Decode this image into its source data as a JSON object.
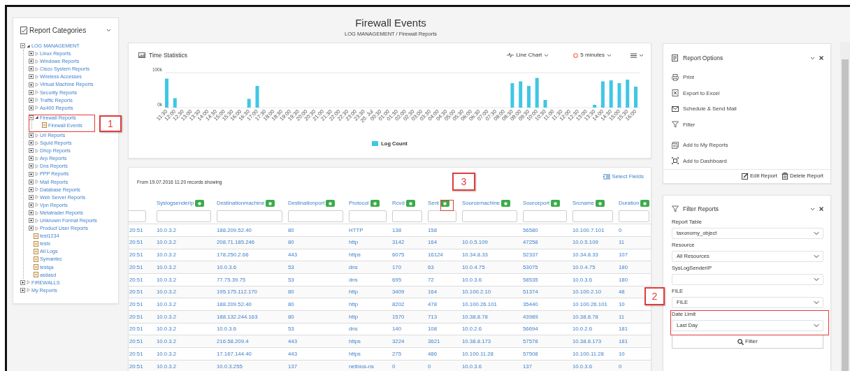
{
  "page": {
    "title": "Firewall Events",
    "breadcrumb": "LOG MANAGEMENT / Firewall Reports"
  },
  "sidebar": {
    "title": "Report Categories",
    "tree": [
      {
        "label": "LOG MANAGEMENT",
        "kind": "folder",
        "expanded": true,
        "children": [
          {
            "label": "Linux Reports",
            "kind": "folder",
            "expanded": false
          },
          {
            "label": "Windows Reports",
            "kind": "folder",
            "expanded": false
          },
          {
            "label": "Cisco System Reports",
            "kind": "folder",
            "expanded": false
          },
          {
            "label": "Wireless Accesses",
            "kind": "folder",
            "expanded": false
          },
          {
            "label": "Virtual Machine Reports",
            "kind": "folder",
            "expanded": false
          },
          {
            "label": "Security Reports",
            "kind": "folder",
            "expanded": false
          },
          {
            "label": "Traffic Reports",
            "kind": "folder",
            "expanded": false
          },
          {
            "label": "As400 Reports",
            "kind": "folder",
            "expanded": false
          },
          {
            "label": "Firewall Reports",
            "kind": "folder",
            "expanded": true,
            "children": [
              {
                "label": "Firewall Events",
                "kind": "report"
              }
            ]
          },
          {
            "label": "Url Reports",
            "kind": "folder",
            "expanded": false
          },
          {
            "label": "Squid Reports",
            "kind": "folder",
            "expanded": false
          },
          {
            "label": "Dhcp Reports",
            "kind": "folder",
            "expanded": false
          },
          {
            "label": "Arp Reports",
            "kind": "folder",
            "expanded": false
          },
          {
            "label": "Dns Reports",
            "kind": "folder",
            "expanded": false
          },
          {
            "label": "PPP Reports",
            "kind": "folder",
            "expanded": false
          },
          {
            "label": "Mail Reports",
            "kind": "folder",
            "expanded": false
          },
          {
            "label": "Database Reports",
            "kind": "folder",
            "expanded": false
          },
          {
            "label": "Web Server Reports",
            "kind": "folder",
            "expanded": false
          },
          {
            "label": "Vpn Reports",
            "kind": "folder",
            "expanded": false
          },
          {
            "label": "Metatrader Reports",
            "kind": "folder",
            "expanded": false
          },
          {
            "label": "Unknown Format Reports",
            "kind": "folder",
            "expanded": false
          },
          {
            "label": "Product User Reports",
            "kind": "folder",
            "expanded": false
          },
          {
            "label": "test1234",
            "kind": "report"
          },
          {
            "label": "testx",
            "kind": "report"
          },
          {
            "label": "All Logs",
            "kind": "report"
          },
          {
            "label": "Symantec",
            "kind": "report"
          },
          {
            "label": "testqa",
            "kind": "report"
          },
          {
            "label": "asdasd",
            "kind": "report"
          }
        ]
      },
      {
        "label": "FIREWALLS",
        "kind": "folder",
        "expanded": false
      },
      {
        "label": "My Reports",
        "kind": "folder",
        "expanded": false
      }
    ]
  },
  "time_statistics": {
    "title": "Time Statistics",
    "chart_type": "Line Chart",
    "interval": "5 minutes",
    "chart_data": {
      "type": "bar",
      "categories": [
        "11:30",
        "12:00",
        "12:30",
        "13:00",
        "13:30",
        "14:00",
        "14:30",
        "15:00",
        "15:30",
        "16:00",
        "16:30",
        "17:00",
        "17:30",
        "18:00",
        "18:30",
        "19:00",
        "19:30",
        "20:00",
        "20:30",
        "21:00",
        "21:30",
        "22:00",
        "22:30",
        "23:00",
        "23:30",
        "20. Jul",
        "00:30",
        "01:00",
        "01:30",
        "02:00",
        "02:30",
        "03:00",
        "03:30",
        "04:00",
        "04:30",
        "05:00",
        "05:30",
        "06:00",
        "06:30",
        "07:00",
        "07:30",
        "08:00",
        "08:30",
        "09:00",
        "09:30",
        "10:00",
        "10:30",
        "11:00",
        "11:30",
        "12:00",
        "12:30",
        "13:00",
        "13:30",
        "14:00",
        "14:30",
        "15:00",
        "15:30",
        "16:00"
      ],
      "series": [
        {
          "name": "Log Count",
          "color": "#3fc7e4",
          "values": [
            83,
            27,
            0,
            0,
            0,
            0,
            0,
            0,
            0,
            0,
            25,
            62,
            0,
            0,
            0,
            0,
            0,
            0,
            0,
            0,
            0,
            0,
            0,
            0,
            0,
            0,
            0,
            0,
            0,
            0,
            0,
            0,
            0,
            0,
            0,
            0,
            0,
            0,
            0,
            0,
            0,
            0,
            70,
            75,
            62,
            85,
            22,
            0,
            0,
            0,
            0,
            0,
            8,
            75,
            78,
            70,
            80,
            60
          ]
        }
      ],
      "ylim": [
        0,
        100
      ],
      "yticks": [
        {
          "value": 0,
          "label": "0k"
        },
        {
          "value": 100,
          "label": "100k"
        }
      ]
    }
  },
  "records": {
    "info": "From 19.07.2016 11:20 records showing",
    "select_fields": "Select Fields",
    "columns": [
      "",
      "Syslogsenderip",
      "Destinationmachine",
      "Destinationport",
      "Protocol",
      "Rcvd",
      "Sent",
      "Sourcemachine",
      "Sourceport",
      "Srcname",
      "Duration"
    ],
    "rows": [
      [
        "20:51",
        "10.0.3.2",
        "188.209.52.40",
        "80",
        "HTTP",
        "138",
        "158",
        null,
        "56580",
        "10.100.7.101",
        "0"
      ],
      [
        "20:51",
        "10.0.3.2",
        "208.71.185.246",
        "80",
        "http",
        "3142",
        "164",
        "10.0.5.109",
        "47258",
        "10.0.5.109",
        "11"
      ],
      [
        "20:51",
        "10.0.3.2",
        "178.250.2.66",
        "443",
        "https",
        "6075",
        "16124",
        "10.34.8.33",
        "52337",
        "10.34.8.33",
        "107"
      ],
      [
        "20:51",
        "10.0.3.2",
        "10.0.3.6",
        "53",
        "dns",
        "170",
        "63",
        "10.0.4.75",
        "53075",
        "10.0.4.75",
        "180"
      ],
      [
        "20:51",
        "10.0.3.2",
        "77.75.39.75",
        "53",
        "dns",
        "695",
        "72",
        "10.0.3.6",
        "58535",
        "10.0.3.6",
        "180"
      ],
      [
        "20:51",
        "10.0.3.2",
        "195.175.112.170",
        "80",
        "http",
        "3409",
        "164",
        "10.100.2.10",
        "51374",
        "10.100.2.10",
        "48"
      ],
      [
        "20:51",
        "10.0.3.2",
        "188.209.52.40",
        "80",
        "http",
        "8202",
        "478",
        "10.100.26.101",
        "35440",
        "10.100.26.101",
        "10"
      ],
      [
        "20:51",
        "10.0.3.2",
        "188.132.244.163",
        "80",
        "http",
        "1570",
        "713",
        "10.38.8.78",
        "43989",
        "10.38.8.78",
        "11"
      ],
      [
        "20:51",
        "10.0.3.2",
        "10.0.3.6",
        "53",
        "dns",
        "140",
        "108",
        "10.0.2.6",
        "56694",
        "10.0.2.6",
        "181"
      ],
      [
        "20:51",
        "10.0.3.2",
        "216.58.209.4",
        "443",
        "https",
        "3224",
        "3621",
        "10.38.8.173",
        "57578",
        "10.38.8.173",
        "181"
      ],
      [
        "20:51",
        "10.0.3.2",
        "17.167.144.40",
        "443",
        "https",
        "275",
        "486",
        "10.100.11.28",
        "57508",
        "10.100.11.28",
        "10"
      ],
      [
        "20:51",
        "10.0.3.2",
        "10.0.3.255",
        "137",
        "netbios-ns",
        "0",
        "0",
        "10.0.3.6",
        "137",
        "10.0.3.6",
        "0"
      ]
    ]
  },
  "report_options": {
    "title": "Report Options",
    "item_groups": [
      [
        {
          "label": "Print",
          "kind": "print"
        },
        {
          "label": "Export to Excel",
          "kind": "excel"
        },
        {
          "label": "Schedule & Send Mail",
          "kind": "mail"
        },
        {
          "label": "Filter",
          "kind": "filter"
        }
      ],
      [
        {
          "label": "Add to My Reports",
          "kind": "my_reports"
        },
        {
          "label": "Add to Dashboard",
          "kind": "dashboard"
        }
      ]
    ],
    "footer": [
      {
        "label": "Edit Report",
        "kind": "edit"
      },
      {
        "label": "Delete Report",
        "kind": "delete"
      }
    ]
  },
  "filter_reports": {
    "title": "Filter Reports",
    "fields": [
      {
        "label": "Report Table",
        "value": "taxonomy_object"
      },
      {
        "label": "Resource",
        "value": "All Resources"
      },
      {
        "label": "SysLogSenderIP"
      },
      {
        "label": "FILE",
        "value": "FILE"
      },
      {
        "label": "Date Limit",
        "value": "Last Day"
      }
    ],
    "button": "Filter"
  },
  "annotations": [
    {
      "label": "1"
    },
    {
      "label": "2"
    },
    {
      "label": "3"
    }
  ]
}
